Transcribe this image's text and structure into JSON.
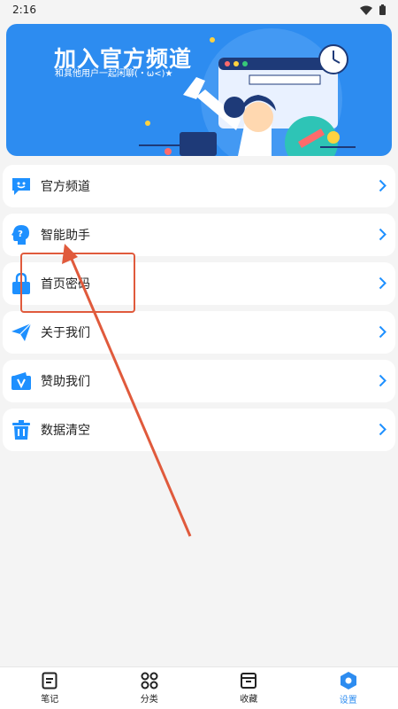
{
  "status_bar": {
    "time": "2:16"
  },
  "banner": {
    "title": "加入官方频道",
    "subtitle": "和其他用户一起闲聊(・ω<)★"
  },
  "menu": {
    "items": [
      {
        "label": "官方频道",
        "icon": "chat-smile-icon"
      },
      {
        "label": "智能助手",
        "icon": "ai-head-icon"
      },
      {
        "label": "首页密码",
        "icon": "lock-icon"
      },
      {
        "label": "关于我们",
        "icon": "paper-plane-icon"
      },
      {
        "label": "赞助我们",
        "icon": "wallet-v-icon"
      },
      {
        "label": "数据清空",
        "icon": "trash-icon"
      }
    ]
  },
  "bottom_nav": {
    "items": [
      {
        "label": "笔记",
        "icon": "note-icon"
      },
      {
        "label": "分类",
        "icon": "grid-circles-icon"
      },
      {
        "label": "收藏",
        "icon": "box-icon"
      },
      {
        "label": "设置",
        "icon": "hexagon-settings-icon",
        "active": true
      }
    ]
  },
  "colors": {
    "accent": "#2d8cf0",
    "background": "#f4f4f4",
    "annotation": "#e05a3c"
  }
}
